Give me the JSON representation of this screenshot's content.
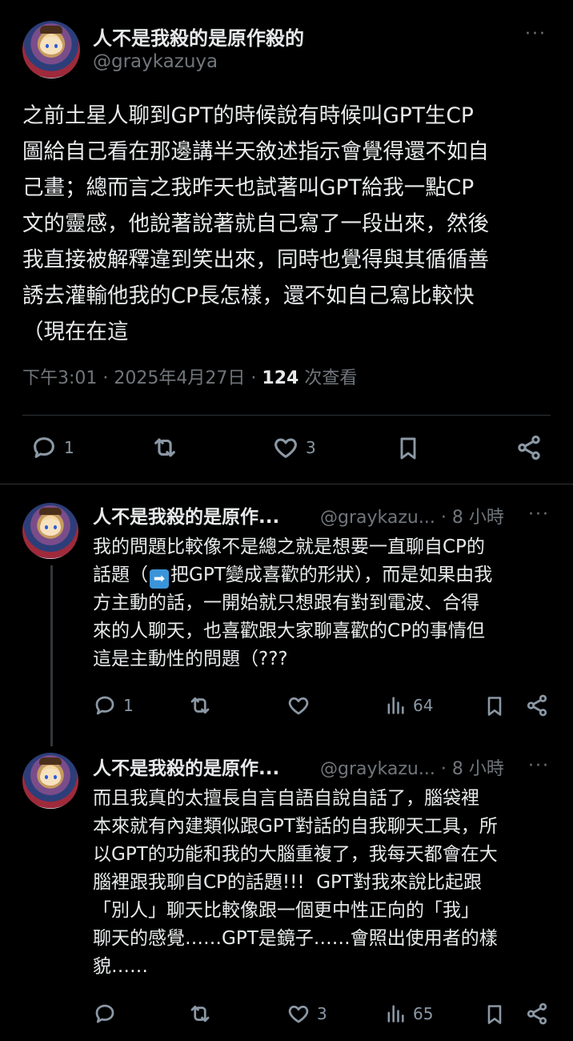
{
  "main_tweet": {
    "author_name": "人不是我殺的是原作殺的",
    "handle": "@graykazuya",
    "more": "···",
    "text": "之前土星人聊到GPT的時候說有時候叫GPT生CP\n圖給自己看在那邊講半天敘述指示會覺得還不如自\n己畫；總而言之我昨天也試著叫GPT給我一點CP\n文的靈感，他說著說著就自己寫了一段出來，然後\n我直接被解釋違到笑出來，同時也覺得與其循循善\n誘去灌輸他我的CP長怎樣，還不如自己寫比較快\n（現在在這",
    "time": "下午3:01",
    "date": "2025年4月27日",
    "views": "124",
    "views_label": "次查看",
    "reply_count": "1",
    "like_count": "3"
  },
  "replies": [
    {
      "author_name": "人不是我殺的是原作...",
      "handle": "@graykazu...",
      "time": "8 小時",
      "more": "···",
      "text_before_emoji": "我的問題比較像不是總之就是想要一直聊自CP的\n話題（",
      "emoji": "➡",
      "text_after_emoji": "把GPT變成喜歡的形狀），而是如果由我\n方主動的話，一開始就只想跟有對到電波、合得\n來的人聊天，也喜歡跟大家聊喜歡的CP的事情但\n這是主動性的問題（???",
      "reply_count": "1",
      "like_count": "",
      "views": "64"
    },
    {
      "author_name": "人不是我殺的是原作...",
      "handle": "@graykazu...",
      "time": "8 小時",
      "more": "···",
      "text": "而且我真的太擅長自言自語自說自話了，腦袋裡\n本來就有內建類似跟GPT對話的自我聊天工具，所\n以GPT的功能和我的大腦重複了，我每天都會在大\n腦裡跟我聊自CP的話題!!!  GPT對我來說比起跟\n「別人」聊天比較像跟一個更中性正向的「我」\n聊天的感覺……GPT是鏡子……會照出使用者的樣\n貌……",
      "reply_count": "",
      "like_count": "3",
      "views": "65"
    }
  ],
  "icons": [
    "reply-icon",
    "retweet-icon",
    "like-icon",
    "bookmark-icon",
    "share-icon",
    "views-icon",
    "more-icon"
  ]
}
